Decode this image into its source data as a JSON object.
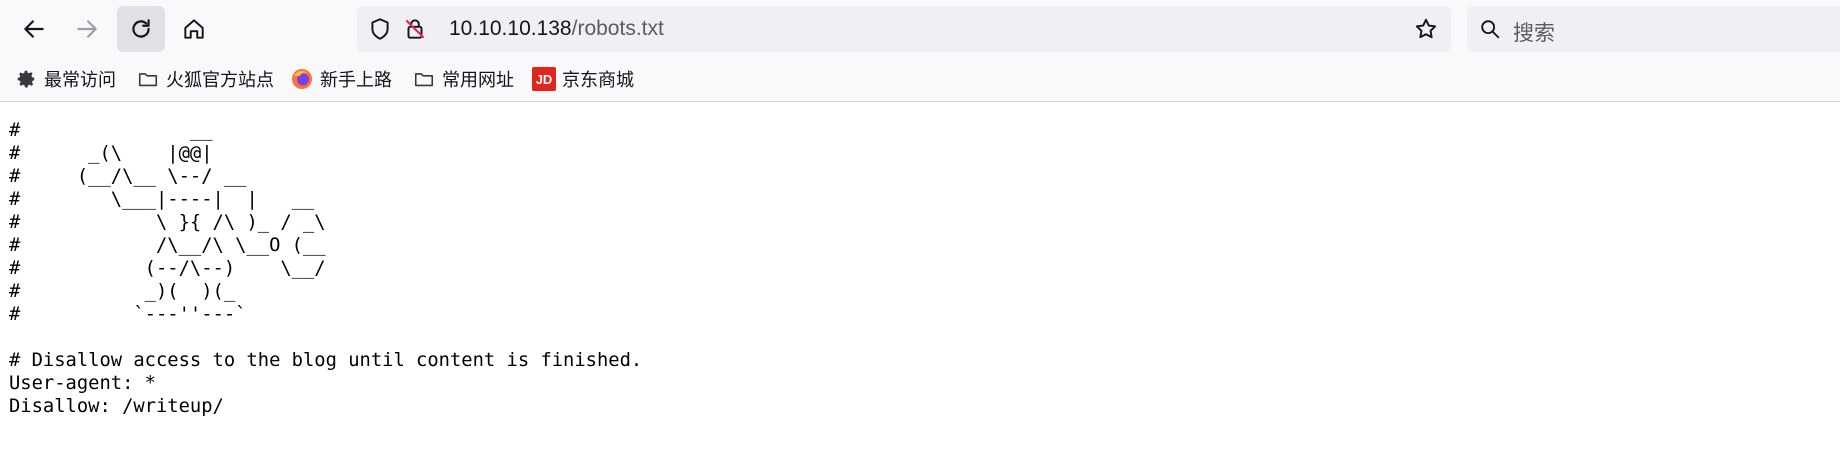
{
  "toolbar": {
    "back_icon": "arrow-left-icon",
    "forward_icon": "arrow-right-icon",
    "reload_icon": "reload-icon",
    "home_icon": "home-icon"
  },
  "urlbar": {
    "host": "10.10.10.138",
    "path": "/robots.txt",
    "shield_icon": "shield-icon",
    "insecure_icon": "insecure-lock-icon",
    "bookmark_icon": "star-icon"
  },
  "search": {
    "placeholder": "搜索",
    "icon": "search-icon"
  },
  "bookmarks": [
    {
      "label": "最常访问",
      "icon": "gear-icon"
    },
    {
      "label": "火狐官方站点",
      "icon": "folder-icon"
    },
    {
      "label": "新手上路",
      "icon": "firefox-icon"
    },
    {
      "label": "常用网址",
      "icon": "folder-icon"
    },
    {
      "label": "京东商城",
      "icon": "jd-icon"
    }
  ],
  "page": {
    "text": "#               __\n#      _(\\    |@@|\n#     (__/\\__ \\--/ __\n#        \\___|----|  |   __\n#            \\ }{ /\\ )_ / _\\\n#            /\\__/\\ \\__O (__\n#           (--/\\--)    \\__/\n#           _)(  )(_\n#          `---''---`\n\n# Disallow access to the blog until content is finished.\nUser-agent: *\nDisallow: /writeup/"
  },
  "colors": {
    "toolbar_bg": "#f9f9fb",
    "urlbar_bg": "#f0f0f4",
    "insecure_red": "#e22850",
    "jd_red": "#e1251b"
  }
}
